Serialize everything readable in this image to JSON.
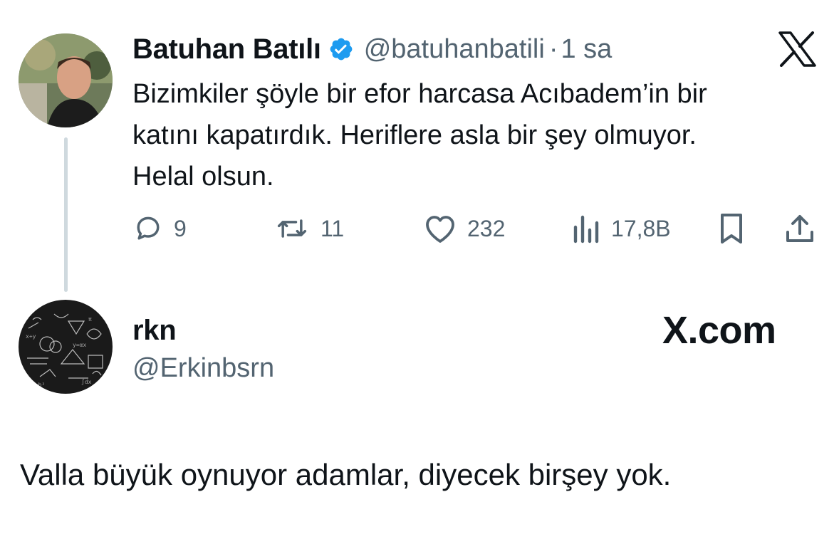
{
  "tweet": {
    "author_name": "Batuhan Batılı",
    "handle": "@batuhanbatili",
    "separator": "·",
    "time": "1 sa",
    "text_lines": [
      "Bizimkiler şöyle bir efor harcasa Acıbadem’in bir",
      "katını kapatırdık. Heriflere asla bir şey olmuyor.",
      "Helal olsun."
    ],
    "actions": {
      "replies": "9",
      "retweets": "11",
      "likes": "232",
      "views": "17,8B"
    }
  },
  "reply": {
    "author_name": "rkn",
    "handle": "@Erkinbsrn",
    "text": "Valla büyük oynuyor adamlar, diyecek birşey yok."
  },
  "watermark": "X.com",
  "colors": {
    "verified": "#1d9bf0",
    "muted": "#536471",
    "thread_line": "#cfd9de"
  },
  "icons": [
    "x-logo-icon",
    "verified-badge-icon",
    "reply-icon",
    "retweet-icon",
    "like-icon",
    "views-icon",
    "bookmark-icon",
    "share-icon"
  ]
}
